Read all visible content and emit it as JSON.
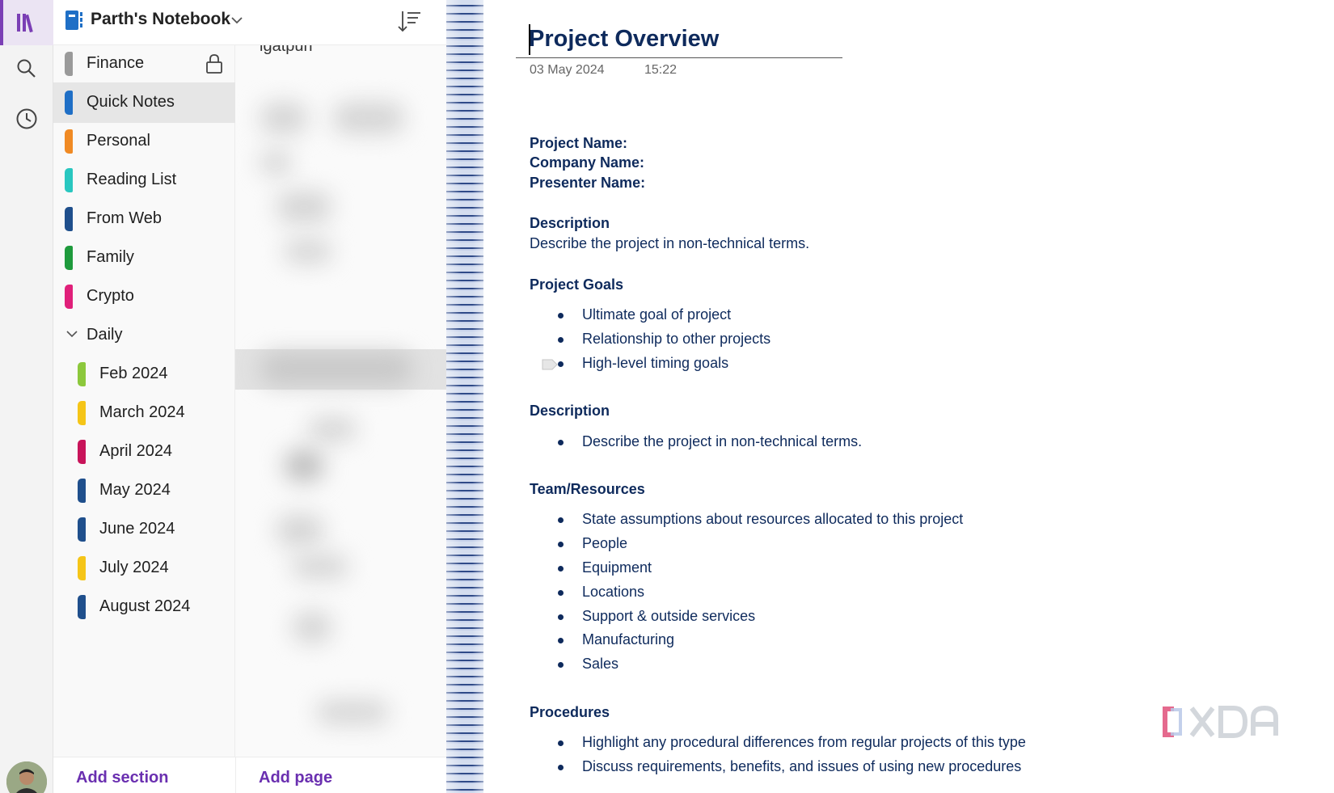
{
  "notebook": {
    "title": "Parth's Notebook"
  },
  "sections": [
    {
      "label": "Finance",
      "color": "#9a9a9a",
      "locked": true
    },
    {
      "label": "Quick Notes",
      "color": "#1f6fc6",
      "selected": true
    },
    {
      "label": "Personal",
      "color": "#f08a24"
    },
    {
      "label": "Reading List",
      "color": "#29c7c0"
    },
    {
      "label": "From Web",
      "color": "#1f4f8c"
    },
    {
      "label": "Family",
      "color": "#1e9a3c"
    },
    {
      "label": "Crypto",
      "color": "#e0207a"
    }
  ],
  "group": {
    "label": "Daily",
    "sections": [
      {
        "label": "Feb 2024",
        "color": "#8cc83c"
      },
      {
        "label": "March 2024",
        "color": "#f5c518"
      },
      {
        "label": "April 2024",
        "color": "#c8145a"
      },
      {
        "label": "May 2024",
        "color": "#1f4f8c"
      },
      {
        "label": "June 2024",
        "color": "#1f4f8c"
      },
      {
        "label": "July 2024",
        "color": "#f5c518"
      },
      {
        "label": "August 2024",
        "color": "#1f4f8c"
      }
    ]
  },
  "pages": {
    "partial_text": "igatpuri"
  },
  "footer": {
    "add_section": "Add section",
    "add_page": "Add page"
  },
  "note": {
    "title": "Project Overview",
    "date": "03 May 2024",
    "time": "15:22",
    "fields": [
      "Project Name:",
      "Company Name:",
      "Presenter Name:"
    ],
    "description_heading": "Description",
    "description_text": "Describe the project in non-technical terms.",
    "goals_heading": "Project Goals",
    "goals": [
      "Ultimate goal of project",
      "Relationship to other projects",
      "High-level timing goals"
    ],
    "description2_heading": "Description",
    "description2_items": [
      "Describe the project in non-technical terms."
    ],
    "team_heading": "Team/Resources",
    "team_items": [
      "State assumptions about resources allocated to this project",
      "People",
      "Equipment",
      "Locations",
      "Support & outside services",
      "Manufacturing",
      "Sales"
    ],
    "procedures_heading": "Procedures",
    "procedures_items": [
      "Highlight any procedural differences from regular projects of this type",
      "Discuss requirements, benefits, and issues of using new procedures"
    ]
  },
  "icons": {
    "rail": [
      "notebooks-icon",
      "search-icon",
      "recent-clock-icon"
    ],
    "header": [
      "notebook-icon",
      "chevron-down-icon",
      "sort-icon"
    ]
  },
  "watermark": "XDA",
  "colors": {
    "accent": "#7b3fb5",
    "note_text": "#0e2a5c"
  }
}
